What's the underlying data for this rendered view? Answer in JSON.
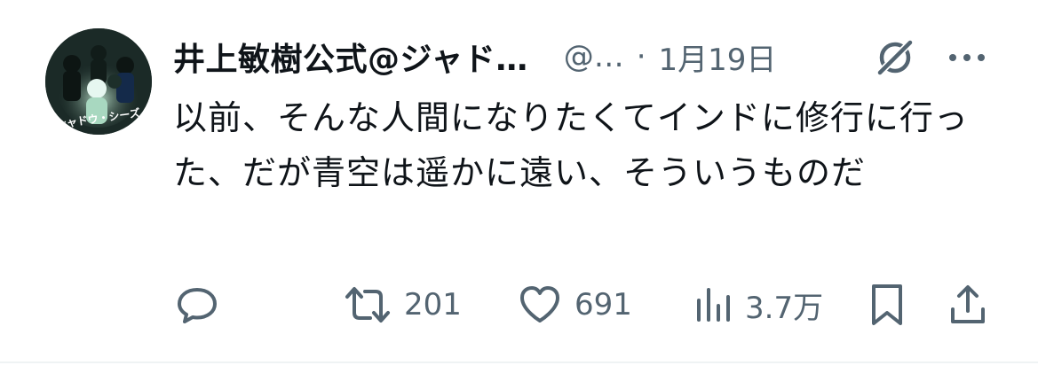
{
  "tweet": {
    "display_name": "井上敏樹公式@ジャド…",
    "handle": "@…",
    "separator": "·",
    "timestamp": "1月19日",
    "text": "以前、そんな人間になりたくてインドに修行に行った、だが青空は遥かに遠い、そういうものだ",
    "avatar_text": "シャドウ・シーズ"
  },
  "actions": {
    "reply_icon": "reply-icon",
    "retweet_icon": "retweet-icon",
    "retweet_count": "201",
    "like_icon": "heart-icon",
    "like_count": "691",
    "views_icon": "views-icon",
    "views_count": "3.7万",
    "bookmark_icon": "bookmark-icon",
    "share_icon": "share-icon"
  },
  "colors": {
    "text_primary": "#0f1419",
    "text_secondary": "#536471",
    "divider": "#eff3f4"
  }
}
